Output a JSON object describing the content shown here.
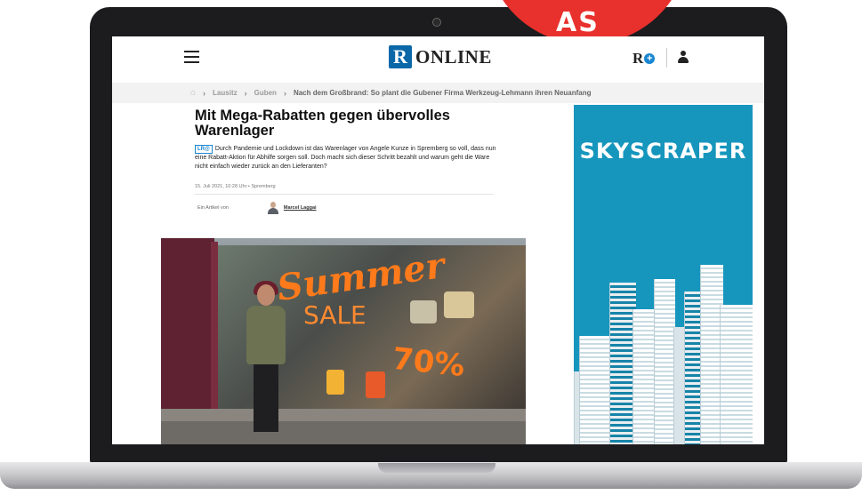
{
  "badge": {
    "text": "AS"
  },
  "header": {
    "logo_mark": "R",
    "logo_text": "ONLINE",
    "rplus_letter": "R",
    "rplus_symbol": "+"
  },
  "breadcrumb": {
    "home_icon": "⌂",
    "items": [
      "Lausitz",
      "Guben"
    ],
    "current": "Nach dem Großbrand: So plant die Gubener Firma Werkzeug-Lehmann ihren Neuanfang"
  },
  "article": {
    "headline": "Mit Mega-Rabatten gegen übervolles Warenlager",
    "tag": "LR@",
    "teaser": "Durch Pandemie und Lockdown ist das Warenlager von Angele Kunze in Spremberg so voll, dass nun eine Rabatt-Aktion für Abhilfe sorgen soll. Doch macht sich dieser Schritt bezahlt und warum geht die Ware nicht einfach wieder zurück an den Lieferanten?",
    "meta": "15. Juli 2021, 10:28 Uhr  •  Spremberg",
    "author_prefix": "Ein Artikel von",
    "author_name": "Marcel Laggai"
  },
  "photo": {
    "sign_line1": "Summer",
    "sign_line2": "SALE",
    "sign_pct": "70%"
  },
  "ad": {
    "label": "SKYSCRAPER"
  },
  "colors": {
    "brand_blue": "#0a67a8",
    "badge_red": "#e8302d",
    "ad_blue": "#1796bd"
  }
}
